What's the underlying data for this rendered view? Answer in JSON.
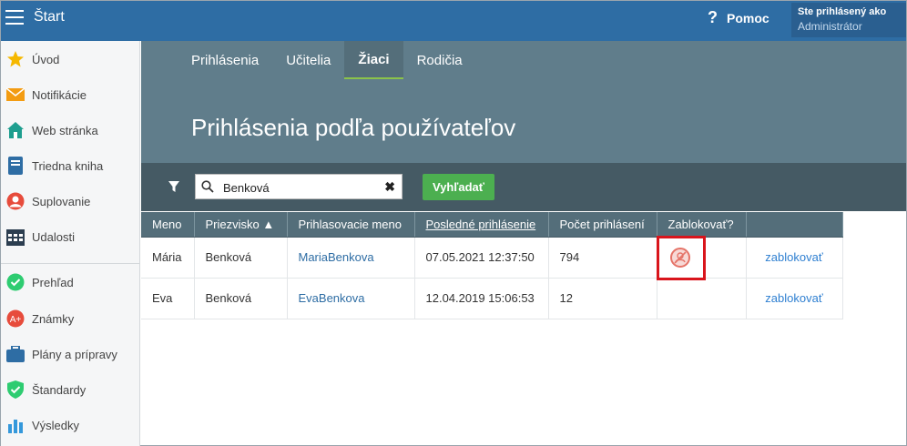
{
  "header": {
    "app_title": "Štart",
    "help_label": "Pomoc",
    "login_line1": "Ste prihlásený ako",
    "login_line2": "Administrátor"
  },
  "sidebar": {
    "items": [
      {
        "label": "Úvod",
        "icon": "star-icon"
      },
      {
        "label": "Notifikácie",
        "icon": "envelope-icon"
      },
      {
        "label": "Web stránka",
        "icon": "home-icon"
      },
      {
        "label": "Triedna kniha",
        "icon": "book-icon"
      },
      {
        "label": "Suplovanie",
        "icon": "user-icon"
      },
      {
        "label": "Udalosti",
        "icon": "calendar-icon"
      },
      {
        "label": "Prehľad",
        "icon": "check-circle-icon"
      },
      {
        "label": "Známky",
        "icon": "grade-icon"
      },
      {
        "label": "Plány a prípravy",
        "icon": "briefcase-icon"
      },
      {
        "label": "Štandardy",
        "icon": "shield-icon"
      },
      {
        "label": "Výsledky",
        "icon": "bar-chart-icon"
      }
    ]
  },
  "tabs": [
    {
      "label": "Prihlásenia"
    },
    {
      "label": "Učitelia"
    },
    {
      "label": "Žiaci"
    },
    {
      "label": "Rodičia"
    }
  ],
  "active_tab": "Žiaci",
  "page_title": "Prihlásenia podľa používateľov",
  "search": {
    "value": "Benková",
    "button_label": "Vyhľadať"
  },
  "table": {
    "columns": [
      "Meno",
      "Priezvisko ▲",
      "Prihlasovacie meno",
      "Posledné prihlásenie",
      "Počet prihlásení",
      "Zablokovať?",
      ""
    ],
    "rows": [
      {
        "meno": "Mária",
        "priezvisko": "Benková",
        "login": "MariaBenkova",
        "last": "07.05.2021 12:37:50",
        "count": "794",
        "blocked": true,
        "action": "zablokovať"
      },
      {
        "meno": "Eva",
        "priezvisko": "Benková",
        "login": "EvaBenkova",
        "last": "12.04.2019 15:06:53",
        "count": "12",
        "blocked": false,
        "action": "zablokovať"
      }
    ]
  },
  "colors": {
    "topbar": "#2e6da4",
    "header": "#607d8b",
    "filter_bar": "#455a64",
    "accent_green": "#4caf50",
    "highlight": "#d9151c"
  }
}
